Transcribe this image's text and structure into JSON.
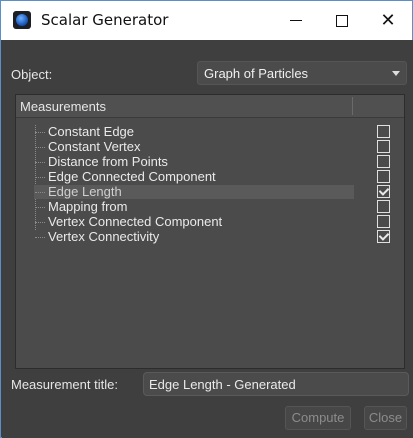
{
  "window": {
    "title": "Scalar Generator",
    "min_glyph": "—",
    "close_glyph": "✕"
  },
  "object": {
    "label": "Object:",
    "value": "Graph of Particles"
  },
  "measurements": {
    "header": "Measurements",
    "items": [
      {
        "label": "Constant Edge",
        "checked": false
      },
      {
        "label": "Constant Vertex",
        "checked": false
      },
      {
        "label": "Distance from Points",
        "checked": false
      },
      {
        "label": "Edge Connected Component",
        "checked": false
      },
      {
        "label": "Edge Length",
        "checked": true
      },
      {
        "label": "Mapping from",
        "checked": false
      },
      {
        "label": "Vertex Connected Component",
        "checked": false
      },
      {
        "label": "Vertex Connectivity",
        "checked": true
      }
    ],
    "selected_item": "Edge Length"
  },
  "measurement_title": {
    "label": "Measurement title:",
    "value": "Edge Length - Generated"
  },
  "buttons": {
    "compute": "Compute",
    "close": "Close"
  },
  "colors": {
    "background": "#3f3f3f",
    "panel": "#4b4b4b",
    "text": "#e6e6e6",
    "disabled_text": "#8c8c8c"
  }
}
